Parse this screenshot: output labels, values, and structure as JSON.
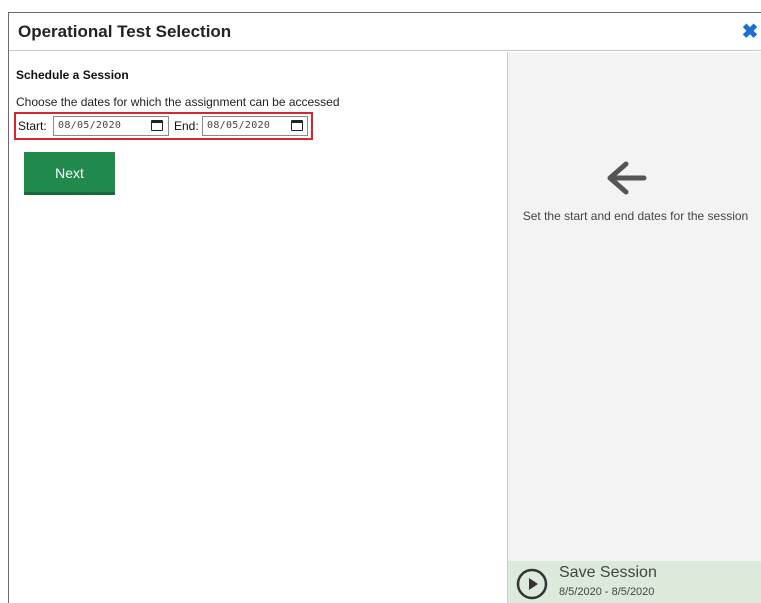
{
  "dialog": {
    "title": "Operational Test Selection",
    "close_icon": "close-icon"
  },
  "schedule": {
    "section_title": "Schedule a Session",
    "instructions": "Choose the dates for which the assignment can be accessed",
    "start_label": "Start:",
    "start_value": "08/05/2020",
    "end_label": "End:",
    "end_value": "08/05/2020",
    "calendar_icon": "calendar-icon"
  },
  "actions": {
    "next_label": "Next"
  },
  "sidebar": {
    "arrow_icon": "arrow-left-icon",
    "hint": "Set the start and end dates for the session",
    "save_icon": "play-circle-icon",
    "save_label": "Save Session",
    "save_dates": "8/5/2020 - 8/5/2020"
  },
  "colors": {
    "accent_blue": "#1e6fd0",
    "next_green": "#1f8a4c",
    "highlight_red": "#d9262c",
    "save_bg": "#dbeadb",
    "right_pane_bg": "#f3f3f3"
  }
}
